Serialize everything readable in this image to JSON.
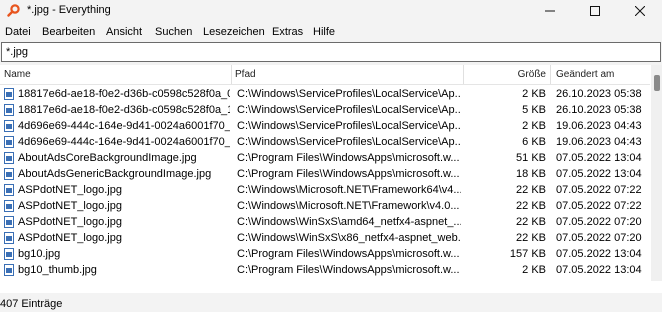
{
  "window": {
    "title": "*.jpg - Everything",
    "icon": "search-magnifier-icon"
  },
  "window_controls": {
    "minimize": "—",
    "maximize": "☐",
    "close": "✕"
  },
  "menu": [
    "Datei",
    "Bearbeiten",
    "Ansicht",
    "Suchen",
    "Lesezeichen",
    "Extras",
    "Hilfe"
  ],
  "search": {
    "value": "*.jpg"
  },
  "columns": {
    "name": "Name",
    "path": "Pfad",
    "size": "Größe",
    "modified": "Geändert am"
  },
  "rows": [
    {
      "name": "18817e6d-ae18-f0e2-d36b-c0598c528f0a_0...",
      "path": "C:\\Windows\\ServiceProfiles\\LocalService\\Ap...",
      "size": "2 KB",
      "modified": "26.10.2023 05:38"
    },
    {
      "name": "18817e6d-ae18-f0e2-d36b-c0598c528f0a_1...",
      "path": "C:\\Windows\\ServiceProfiles\\LocalService\\Ap...",
      "size": "5 KB",
      "modified": "26.10.2023 05:38"
    },
    {
      "name": "4d696e69-444c-164e-9d41-0024a6001f70_2...",
      "path": "C:\\Windows\\ServiceProfiles\\LocalService\\Ap...",
      "size": "2 KB",
      "modified": "19.06.2023 04:43"
    },
    {
      "name": "4d696e69-444c-164e-9d41-0024a6001f70_3...",
      "path": "C:\\Windows\\ServiceProfiles\\LocalService\\Ap...",
      "size": "6 KB",
      "modified": "19.06.2023 04:43"
    },
    {
      "name": "AboutAdsCoreBackgroundImage.jpg",
      "path": "C:\\Program Files\\WindowsApps\\microsoft.w...",
      "size": "51 KB",
      "modified": "07.05.2022 13:04"
    },
    {
      "name": "AboutAdsGenericBackgroundImage.jpg",
      "path": "C:\\Program Files\\WindowsApps\\microsoft.w...",
      "size": "18 KB",
      "modified": "07.05.2022 13:04"
    },
    {
      "name": "ASPdotNET_logo.jpg",
      "path": "C:\\Windows\\Microsoft.NET\\Framework64\\v4...",
      "size": "22 KB",
      "modified": "07.05.2022 07:22"
    },
    {
      "name": "ASPdotNET_logo.jpg",
      "path": "C:\\Windows\\Microsoft.NET\\Framework\\v4.0...",
      "size": "22 KB",
      "modified": "07.05.2022 07:22"
    },
    {
      "name": "ASPdotNET_logo.jpg",
      "path": "C:\\Windows\\WinSxS\\amd64_netfx4-aspnet_...",
      "size": "22 KB",
      "modified": "07.05.2022 07:20"
    },
    {
      "name": "ASPdotNET_logo.jpg",
      "path": "C:\\Windows\\WinSxS\\x86_netfx4-aspnet_web...",
      "size": "22 KB",
      "modified": "07.05.2022 07:20"
    },
    {
      "name": "bg10.jpg",
      "path": "C:\\Program Files\\WindowsApps\\microsoft.w...",
      "size": "157 KB",
      "modified": "07.05.2022 13:04"
    },
    {
      "name": "bg10_thumb.jpg",
      "path": "C:\\Program Files\\WindowsApps\\microsoft.w...",
      "size": "2 KB",
      "modified": "07.05.2022 13:04"
    }
  ],
  "status": {
    "count": "407 Einträge"
  }
}
